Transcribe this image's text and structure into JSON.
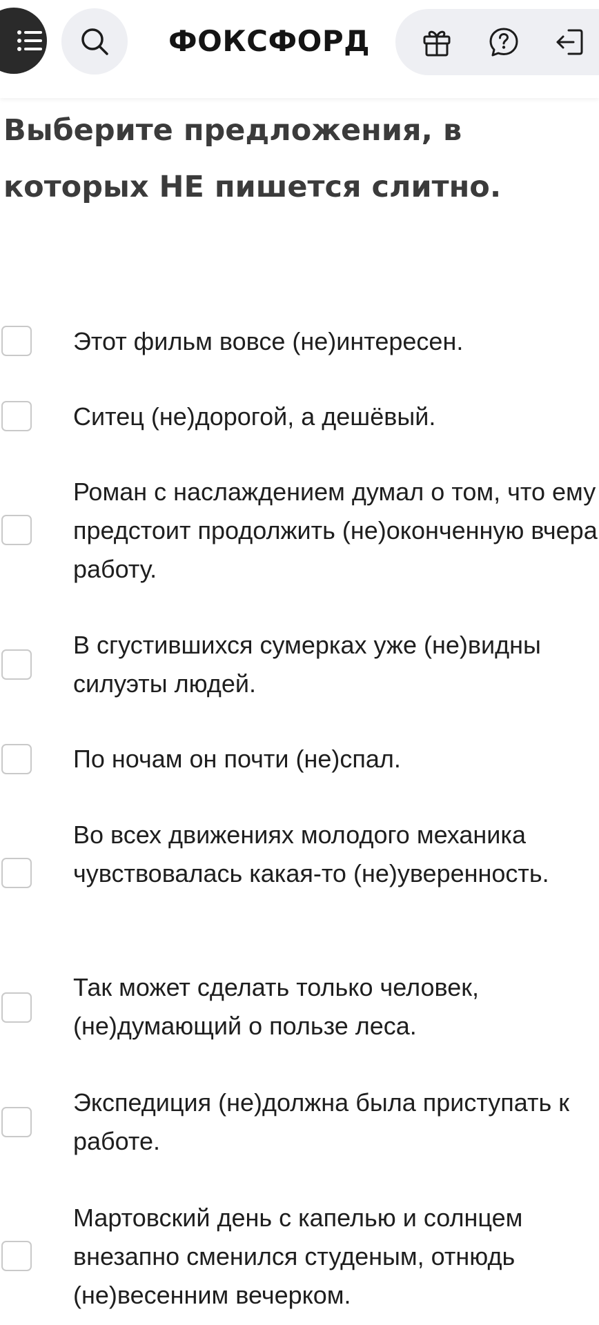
{
  "header": {
    "logo_text": "ФОКСФОРД",
    "icons": {
      "menu": "menu-icon",
      "search": "search-icon",
      "gift": "gift-icon",
      "help": "help-chat-icon",
      "logout": "logout-icon"
    },
    "colors": {
      "menu_bg": "#2a2a2a",
      "pill_bg": "#eeeff3"
    }
  },
  "question": {
    "title": "Выберите предложения, в которых НЕ пишется слитно."
  },
  "options": [
    {
      "text": "Этот фильм вовсе (не)интересен.",
      "checked": false
    },
    {
      "text": "Ситец (не)дорогой, а дешёвый.",
      "checked": false
    },
    {
      "text": "Роман с наслаждением думал о том, что ему предстоит продолжить (не)оконченную вчера работу.",
      "checked": false
    },
    {
      "text": "В сгустившихся сумерках уже (не)видны силуэты людей.",
      "checked": false
    },
    {
      "text": "По ночам он почти (не)спал.",
      "checked": false
    },
    {
      "text": "Во всех движениях молодого механика чувствовалась какая-то (не)уверенность.",
      "checked": false
    },
    {
      "text": "Так может сделать только человек, (не)думающий о пользе леса.",
      "checked": false
    },
    {
      "text": "Экспедиция (не)должна была приступать к работе.",
      "checked": false
    },
    {
      "text": "Мартовский день с капелью и солнцем внезапно сменился студеным, отнюдь (не)весенним вечерком.",
      "checked": false
    }
  ]
}
